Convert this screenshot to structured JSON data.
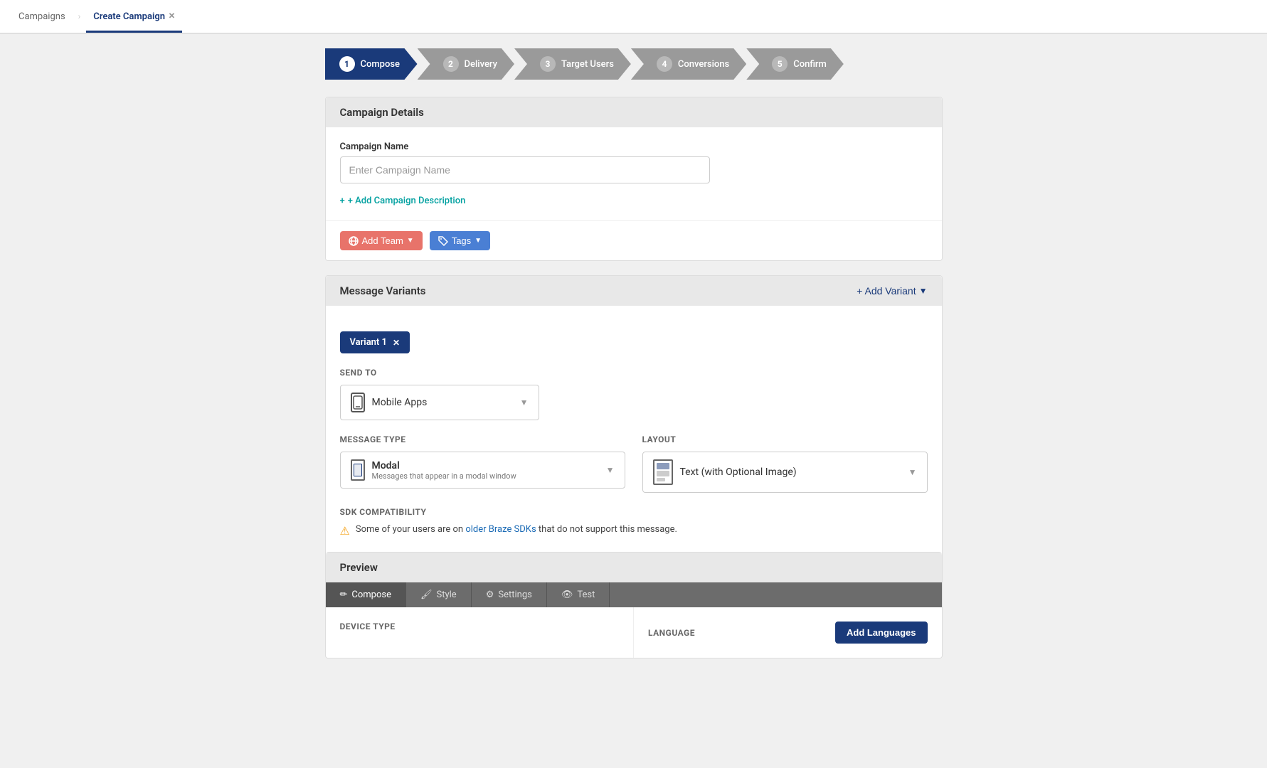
{
  "nav": {
    "campaigns_label": "Campaigns",
    "create_campaign_label": "Create Campaign"
  },
  "wizard": {
    "steps": [
      {
        "number": "1",
        "label": "Compose",
        "active": true
      },
      {
        "number": "2",
        "label": "Delivery",
        "active": false
      },
      {
        "number": "3",
        "label": "Target Users",
        "active": false
      },
      {
        "number": "4",
        "label": "Conversions",
        "active": false
      },
      {
        "number": "5",
        "label": "Confirm",
        "active": false
      }
    ]
  },
  "campaign_details": {
    "header": "Campaign Details",
    "campaign_name_label": "Campaign Name",
    "campaign_name_placeholder": "Enter Campaign Name",
    "add_description_label": "+ Add Campaign Description",
    "add_team_label": "Add Team",
    "tags_label": "Tags"
  },
  "message_variants": {
    "header": "Message Variants",
    "add_variant_label": "+ Add Variant",
    "variant_tab_label": "Variant 1",
    "send_to_label": "SEND TO",
    "send_to_value": "Mobile Apps",
    "message_type_label": "MESSAGE TYPE",
    "modal_name": "Modal",
    "modal_desc": "Messages that appear in a modal window",
    "layout_label": "LAYOUT",
    "layout_value": "Text (with Optional Image)",
    "sdk_compat_label": "SDK COMPATIBILITY",
    "sdk_warning_text": "Some of your users are on",
    "sdk_link_text": "older Braze SDKs",
    "sdk_warning_text2": "that do not support this message."
  },
  "preview": {
    "header": "Preview",
    "tabs": [
      {
        "label": "Compose",
        "icon": "pencil",
        "active": true
      },
      {
        "label": "Style",
        "icon": "paint"
      },
      {
        "label": "Settings",
        "icon": "gear"
      },
      {
        "label": "Test",
        "icon": "eye"
      }
    ],
    "device_type_label": "DEVICE TYPE",
    "language_label": "LANGUAGE",
    "add_languages_label": "Add Languages"
  }
}
